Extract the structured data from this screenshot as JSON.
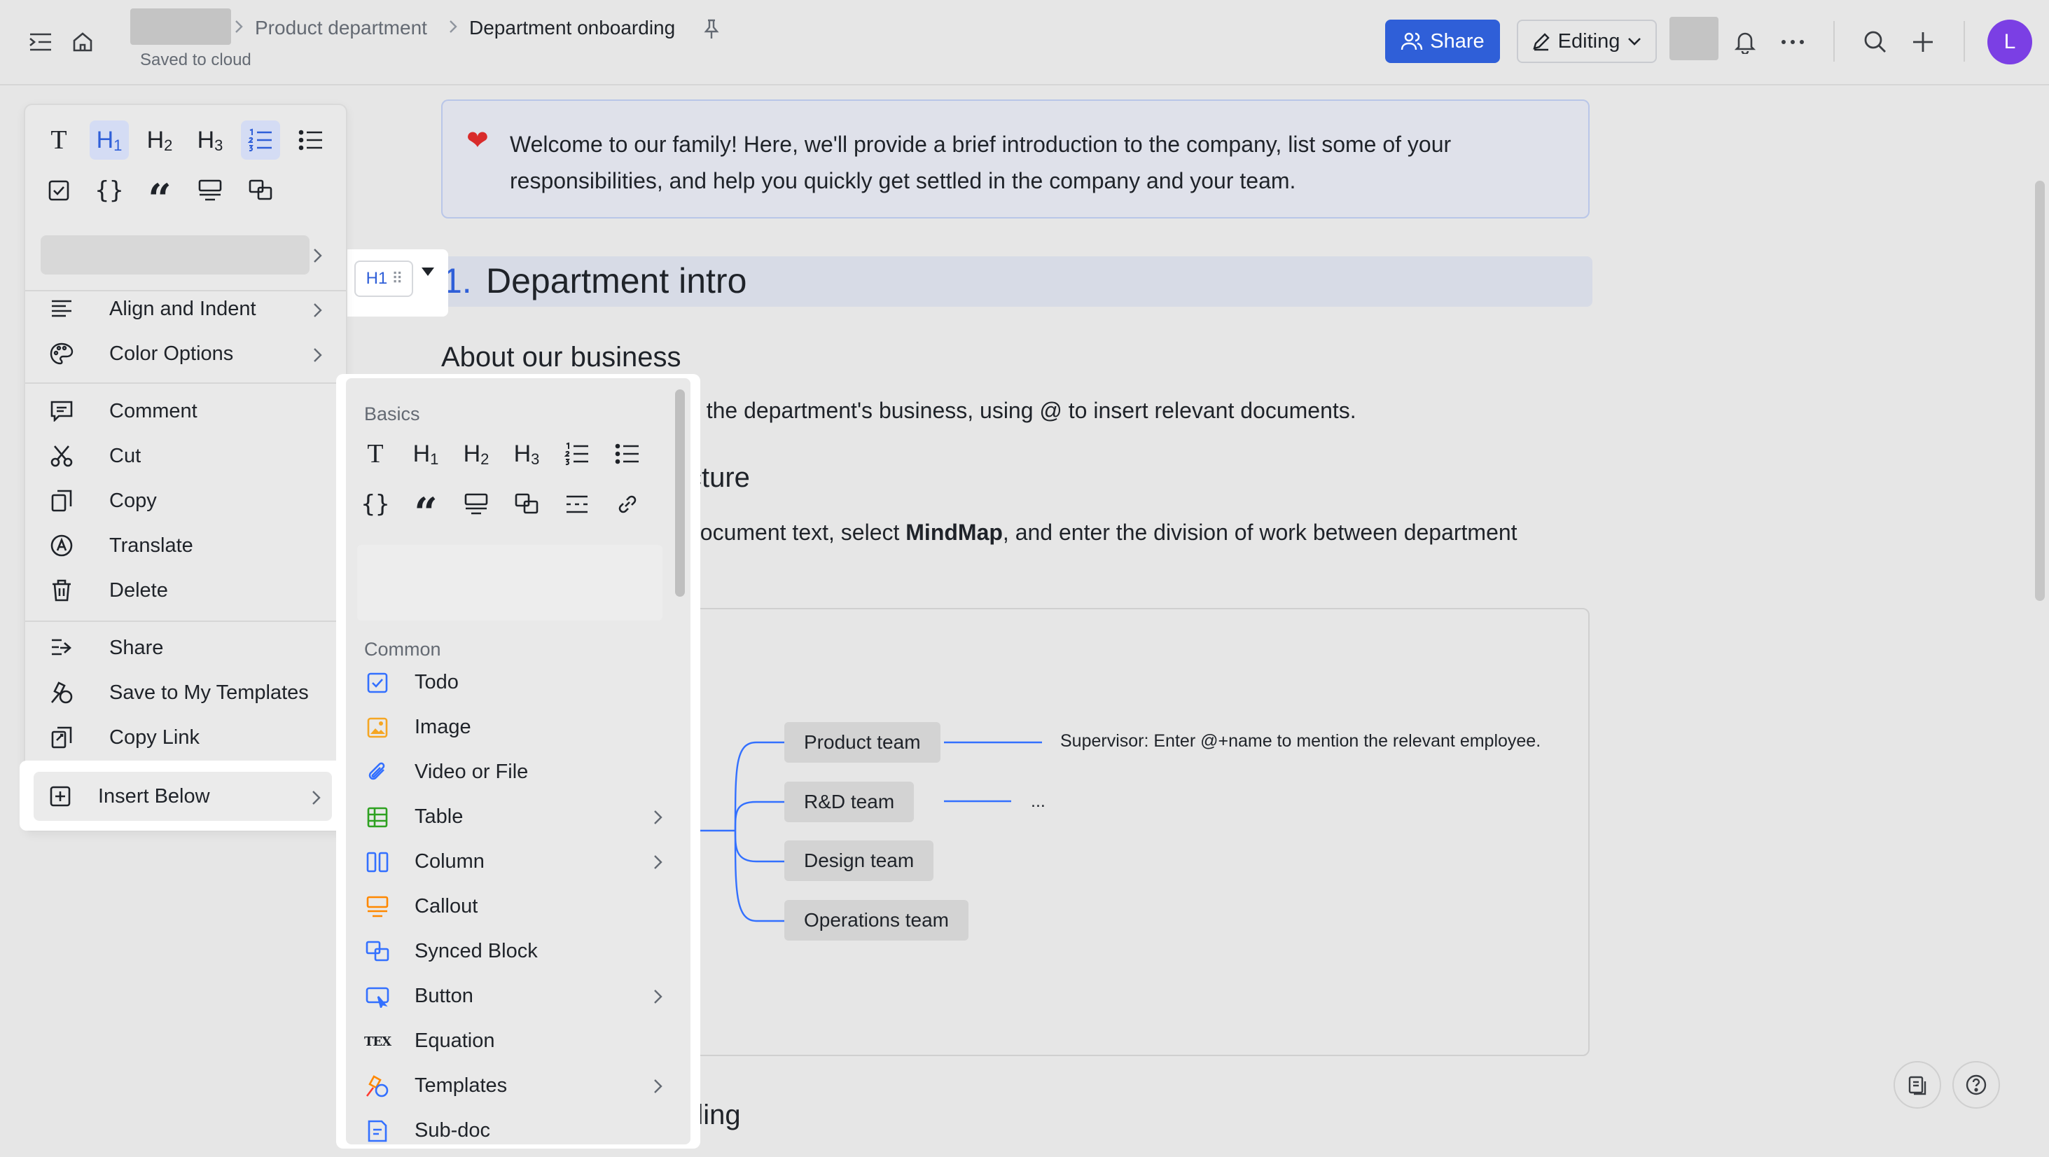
{
  "topbar": {
    "breadcrumb": [
      "Product department",
      "Department onboarding"
    ],
    "saved_status": "Saved to cloud",
    "share_label": "Share",
    "editing_label": "Editing",
    "avatar_initial": "L"
  },
  "document": {
    "callout_text": "Welcome to our family! Here, we'll provide a brief introduction to the company, list some of your responsibilities, and help you quickly get settled in the company and your team.",
    "h1_number": "1.",
    "h1_title": "Department intro",
    "about_heading": "About our business",
    "about_text": "o the department's business, using @ to insert relevant documents.",
    "structure_heading": "cture",
    "structure_text_pre": "document text, select ",
    "structure_text_bold": "MindMap",
    "structure_text_post": ", and enter the division of work between department",
    "bottom_heading": "ding",
    "mindmap": {
      "nodes": [
        "Product team",
        "R&D team",
        "Design team",
        "Operations team"
      ],
      "supervisor_note": "Supervisor: Enter @+name to mention the relevant employee.",
      "ellipsis": "..."
    }
  },
  "handle": {
    "label": "H1",
    "dots": "⠿"
  },
  "context_menu": {
    "items": [
      {
        "label": "Align and Indent",
        "icon": "align-icon",
        "has_submenu": true
      },
      {
        "label": "Color Options",
        "icon": "palette-icon",
        "has_submenu": true
      },
      {
        "label": "Comment",
        "icon": "comment-icon"
      },
      {
        "label": "Cut",
        "icon": "scissors-icon"
      },
      {
        "label": "Copy",
        "icon": "copy-icon"
      },
      {
        "label": "Translate",
        "icon": "translate-icon"
      },
      {
        "label": "Delete",
        "icon": "trash-icon"
      },
      {
        "label": "Share",
        "icon": "share-icon"
      },
      {
        "label": "Save to My Templates",
        "icon": "template-icon"
      },
      {
        "label": "Copy Link",
        "icon": "link-icon"
      },
      {
        "label": "Insert Below",
        "icon": "plus-square-icon",
        "has_submenu": true
      }
    ]
  },
  "insert_menu": {
    "basics_title": "Basics",
    "common_title": "Common",
    "items": [
      {
        "label": "Todo",
        "icon": "checkbox-icon",
        "color": "#3370ff"
      },
      {
        "label": "Image",
        "icon": "image-icon",
        "color": "#f5a623"
      },
      {
        "label": "Video or File",
        "icon": "paperclip-icon",
        "color": "#3370ff"
      },
      {
        "label": "Table",
        "icon": "table-icon",
        "color": "#2ea121",
        "has_submenu": true
      },
      {
        "label": "Column",
        "icon": "column-icon",
        "color": "#3370ff",
        "has_submenu": true
      },
      {
        "label": "Callout",
        "icon": "callout-icon",
        "color": "#ff8800"
      },
      {
        "label": "Synced Block",
        "icon": "synced-block-icon",
        "color": "#3370ff"
      },
      {
        "label": "Button",
        "icon": "button-icon",
        "color": "#3370ff",
        "has_submenu": true
      },
      {
        "label": "Equation",
        "icon": "equation-icon",
        "color": "#1f2329"
      },
      {
        "label": "Templates",
        "icon": "templates-icon",
        "color": "#ff8800",
        "has_submenu": true
      },
      {
        "label": "Sub-doc",
        "icon": "subdoc-icon",
        "color": "#3370ff"
      }
    ],
    "equation_glyph": "TEX"
  },
  "colors": {
    "accent": "#2f5fd8",
    "avatar": "#7b3fe4",
    "callout_bg": "#dfe1ea",
    "heading_highlight": "#d7dbe6"
  }
}
